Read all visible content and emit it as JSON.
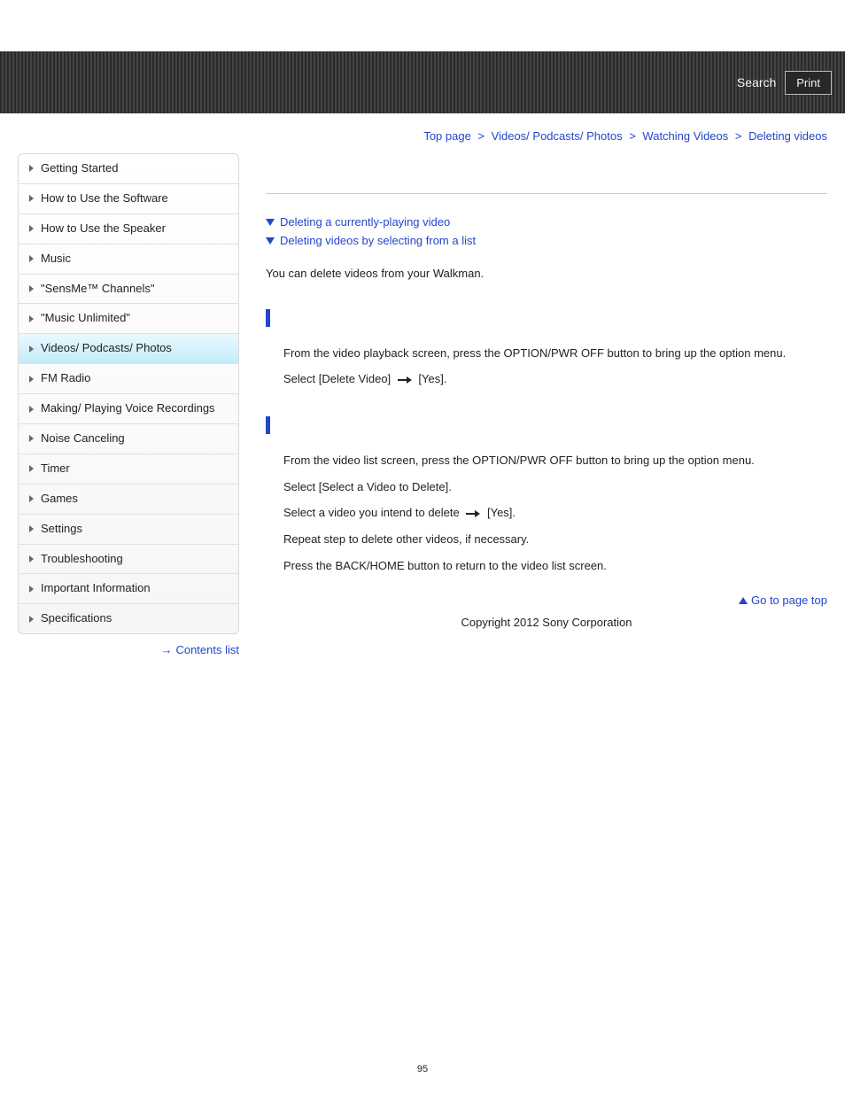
{
  "topbar": {
    "search_label": "Search",
    "print_label": "Print"
  },
  "breadcrumb": {
    "items": [
      {
        "label": "Top page"
      },
      {
        "label": "Videos/ Podcasts/ Photos"
      },
      {
        "label": "Watching Videos"
      }
    ],
    "current": "Deleting videos",
    "sep": ">"
  },
  "sidebar": {
    "items": [
      {
        "label": "Getting Started",
        "active": false
      },
      {
        "label": "How to Use the Software",
        "active": false
      },
      {
        "label": "How to Use the Speaker",
        "active": false
      },
      {
        "label": "Music",
        "active": false
      },
      {
        "label": "\"SensMe™ Channels\"",
        "active": false
      },
      {
        "label": "\"Music Unlimited\"",
        "active": false
      },
      {
        "label": "Videos/ Podcasts/ Photos",
        "active": true
      },
      {
        "label": "FM Radio",
        "active": false
      },
      {
        "label": "Making/ Playing Voice Recordings",
        "active": false
      },
      {
        "label": "Noise Canceling",
        "active": false
      },
      {
        "label": "Timer",
        "active": false
      },
      {
        "label": "Games",
        "active": false
      },
      {
        "label": "Settings",
        "active": false
      },
      {
        "label": "Troubleshooting",
        "active": false
      },
      {
        "label": "Important Information",
        "active": false
      },
      {
        "label": "Specifications",
        "active": false
      }
    ],
    "contents_list_label": "Contents list"
  },
  "main": {
    "anchors": [
      "Deleting a currently-playing video",
      "Deleting videos by selecting from a list"
    ],
    "intro": "You can delete videos from your Walkman.",
    "section1": {
      "step1": "From the video playback screen, press the OPTION/PWR OFF button to bring up the option menu.",
      "step2_before": "Select [Delete Video] ",
      "step2_after": " [Yes]."
    },
    "section2": {
      "step1": "From the video list screen, press the OPTION/PWR OFF button to bring up the option menu.",
      "step2": "Select [Select a Video to Delete].",
      "step3_before": "Select a video you intend to delete ",
      "step3_after": " [Yes].",
      "step4": "Repeat step    to delete other videos, if necessary.",
      "step5": "Press the BACK/HOME button to return to the video list screen."
    },
    "gotop_label": "Go to page top"
  },
  "footer": {
    "copyright": "Copyright 2012 Sony Corporation",
    "page_number": "95"
  }
}
